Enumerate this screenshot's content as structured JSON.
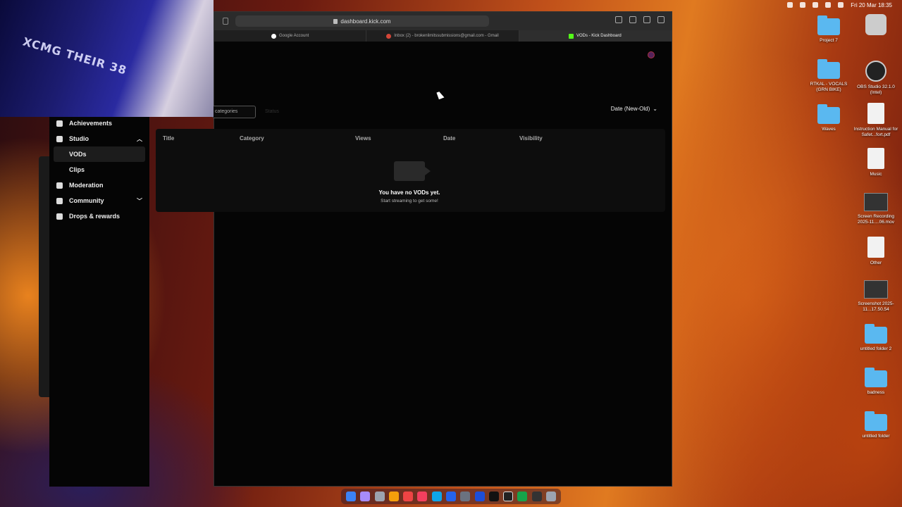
{
  "menubar": {
    "datetime": "Fri 20 Mar  18:35"
  },
  "browser": {
    "url": "dashboard.kick.com",
    "tabs": [
      {
        "label": "Google Account",
        "color": "#ffffff"
      },
      {
        "label": "Inbox (2) - brokenlimitssubmissions@gmail.com - Gmail",
        "color": "#d44638"
      },
      {
        "label": "VODs - Kick Dashboard",
        "color": "#53fc18"
      }
    ]
  },
  "dashboard": {
    "filters": {
      "category_placeholder": "categories",
      "status": "Status",
      "sort": "Date (New-Old)"
    },
    "sidebar": {
      "items": [
        {
          "label": "Achievements",
          "icon": "trophy-icon"
        },
        {
          "label": "Studio",
          "icon": "video-camera-icon",
          "expanded": true
        },
        {
          "label": "VODs",
          "selected": true
        },
        {
          "label": "Clips"
        },
        {
          "label": "Moderation",
          "icon": "hammer-icon"
        },
        {
          "label": "Community",
          "icon": "people-icon",
          "expanded": false
        },
        {
          "label": "Drops & rewards",
          "icon": "gift-icon"
        }
      ]
    },
    "table": {
      "columns": [
        "Title",
        "Category",
        "Views",
        "Date",
        "Visibility"
      ],
      "empty_title": "You have no VODs yet.",
      "empty_subtitle": "Start streaming to get some!"
    }
  },
  "webcam": {
    "overlay_text": "XCMG THEIR 38"
  },
  "desktop": {
    "icons": [
      {
        "label": "Project 7",
        "type": "folder"
      },
      {
        "label": "RTKAL - VOCALS (GRN BIKE)",
        "type": "folder"
      },
      {
        "label": "Waves",
        "type": "folder"
      },
      {
        "label": "OBS Studio 32.1.0 (Intel)",
        "type": "app"
      },
      {
        "label": "Instruction Manual for Safet...fort.pdf",
        "type": "file"
      },
      {
        "label": "Music",
        "type": "file"
      },
      {
        "label": "Screen Recording 2025-11....06.mov",
        "type": "dark"
      },
      {
        "label": "Other",
        "type": "file"
      },
      {
        "label": "Screenshot 2025-11...17.50.54",
        "type": "dark"
      },
      {
        "label": "untitled folder 2",
        "type": "folder"
      },
      {
        "label": "badness",
        "type": "folder"
      },
      {
        "label": "untitled folder",
        "type": "folder"
      }
    ]
  },
  "colors": {
    "dashboard_bg": "#050505",
    "kick_green": "#53fc18"
  }
}
